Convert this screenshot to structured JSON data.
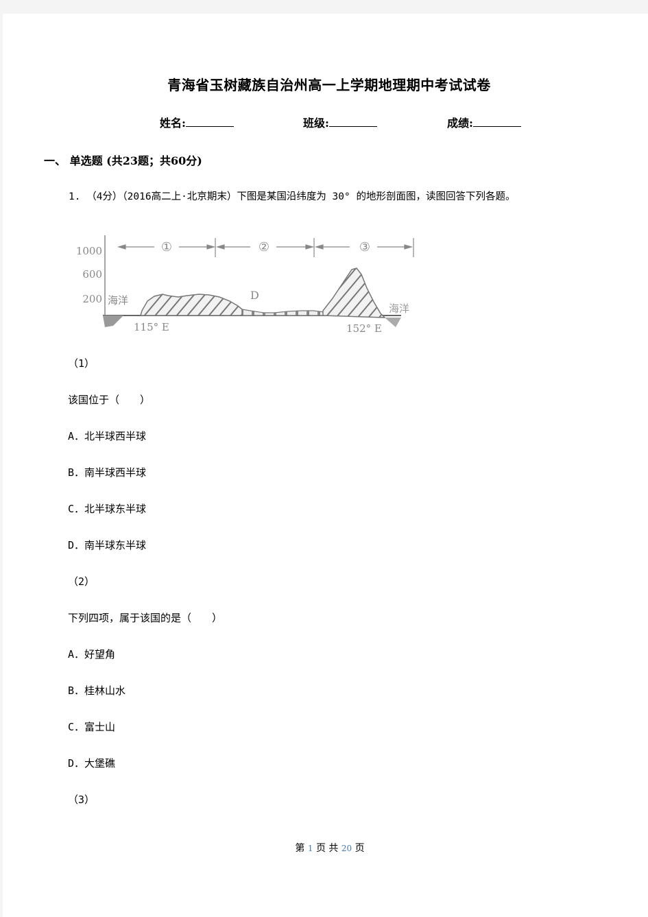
{
  "document": {
    "title": "青海省玉树藏族自治州高一上学期地理期中考试试卷",
    "info_fields": [
      {
        "label": "姓名:"
      },
      {
        "label": "班级:"
      },
      {
        "label": "成绩:"
      }
    ],
    "section_heading": "一、  单选题 (共23题；共60分)",
    "question": {
      "stem": "1. （4分）（2016高二上·北京期末）下图是某国沿纬度为 30° 的地形剖面图，读图回答下列各题。",
      "figure": {
        "y_tick_labels": [
          "1000",
          "600",
          "200"
        ],
        "region_labels": [
          "①",
          "②",
          "③"
        ],
        "point_label": "D",
        "ocean_label_left": "海洋",
        "ocean_label_right": "海洋",
        "lon_left": "115° E",
        "lon_right": "152° E"
      },
      "subquestions": [
        {
          "number": "（1）",
          "prompt": "该国位于（　　）",
          "options": [
            {
              "letter": "A．",
              "text": "北半球西半球"
            },
            {
              "letter": "B．",
              "text": "南半球西半球"
            },
            {
              "letter": "C．",
              "text": "北半球东半球"
            },
            {
              "letter": "D．",
              "text": "南半球东半球"
            }
          ]
        },
        {
          "number": "（2）",
          "prompt": "下列四项，属于该国的是（　　）",
          "options": [
            {
              "letter": "A．",
              "text": "好望角"
            },
            {
              "letter": "B．",
              "text": "桂林山水"
            },
            {
              "letter": "C．",
              "text": "富士山"
            },
            {
              "letter": "D．",
              "text": "大堡礁"
            }
          ]
        },
        {
          "number": "（3）"
        }
      ]
    },
    "footer": {
      "prefix": "第",
      "page": "1",
      "middle": "页 共",
      "total": "20",
      "suffix": "页"
    }
  }
}
